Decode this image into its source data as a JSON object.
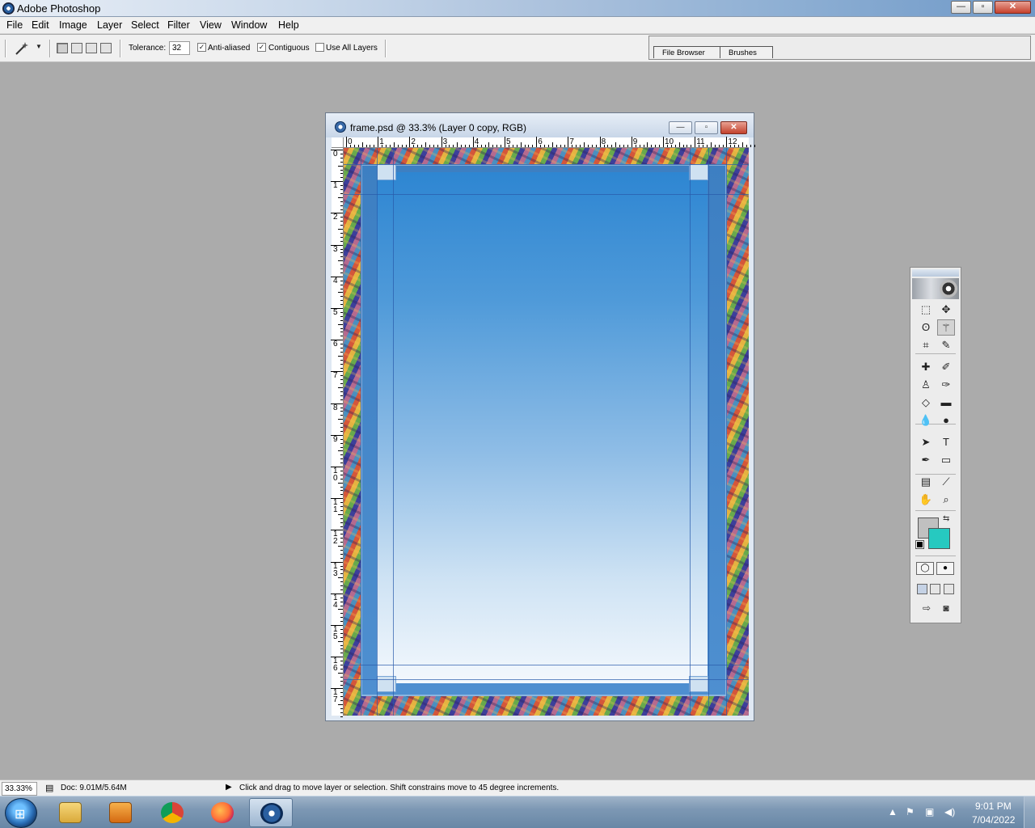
{
  "app": {
    "title": "Adobe Photoshop"
  },
  "window_buttons": {
    "minimize": "—",
    "maximize": "▫",
    "close": "✕"
  },
  "menubar": {
    "items": [
      "File",
      "Edit",
      "Image",
      "Layer",
      "Select",
      "Filter",
      "View",
      "Window",
      "Help"
    ]
  },
  "options_bar": {
    "tool_icon": "magic-wand-icon",
    "tolerance_label": "Tolerance:",
    "tolerance_value": "32",
    "anti_aliased_label": "Anti-aliased",
    "anti_aliased_checked": true,
    "contiguous_label": "Contiguous",
    "contiguous_checked": true,
    "use_all_layers_label": "Use All Layers",
    "use_all_layers_checked": false,
    "palette_well_tabs": [
      "File Browser",
      "Brushes"
    ]
  },
  "document": {
    "title": "frame.psd @ 33.3% (Layer 0 copy, RGB)",
    "ruler_top_labels": [
      "0",
      "1",
      "2",
      "3",
      "4",
      "5",
      "6",
      "7",
      "8",
      "9",
      "10",
      "11",
      "12"
    ],
    "ruler_left_labels": [
      "0",
      "1",
      "2",
      "3",
      "4",
      "5",
      "6",
      "7",
      "8",
      "9",
      "1 0",
      "1 1",
      "1 2",
      "1 3",
      "1 4",
      "1 5",
      "1 6",
      "1 7"
    ],
    "colors": {
      "frame_blue": "#3d7fc2",
      "gradient_top": "#2e86d2",
      "gradient_bottom": "#f3f8fd"
    }
  },
  "toolbox": {
    "tools": [
      "rectangular-marquee-icon",
      "move-icon",
      "lasso-icon",
      "magic-wand-icon",
      "crop-icon",
      "slice-icon",
      "healing-brush-icon",
      "brush-icon",
      "clone-stamp-icon",
      "history-brush-icon",
      "eraser-icon",
      "gradient-icon",
      "blur-icon",
      "dodge-icon",
      "path-selection-icon",
      "type-icon",
      "pen-icon",
      "rectangle-shape-icon",
      "notes-icon",
      "eyedropper-icon",
      "hand-icon",
      "zoom-icon"
    ],
    "active_tool": "magic-wand-icon",
    "foreground_color": "#c0c0c0",
    "background_color": "#26c9c0"
  },
  "statusbar": {
    "zoom": "33.33%",
    "doc_info": "Doc: 9.01M/5.64M",
    "hint": "Click and drag to move layer or selection. Shift constrains move to 45 degree increments."
  },
  "taskbar": {
    "apps": [
      "file-explorer-icon",
      "media-player-icon",
      "chrome-icon",
      "firefox-icon",
      "photoshop-icon"
    ],
    "active_app": "photoshop-icon",
    "time": "9:01 PM",
    "date": "7/04/2022"
  }
}
